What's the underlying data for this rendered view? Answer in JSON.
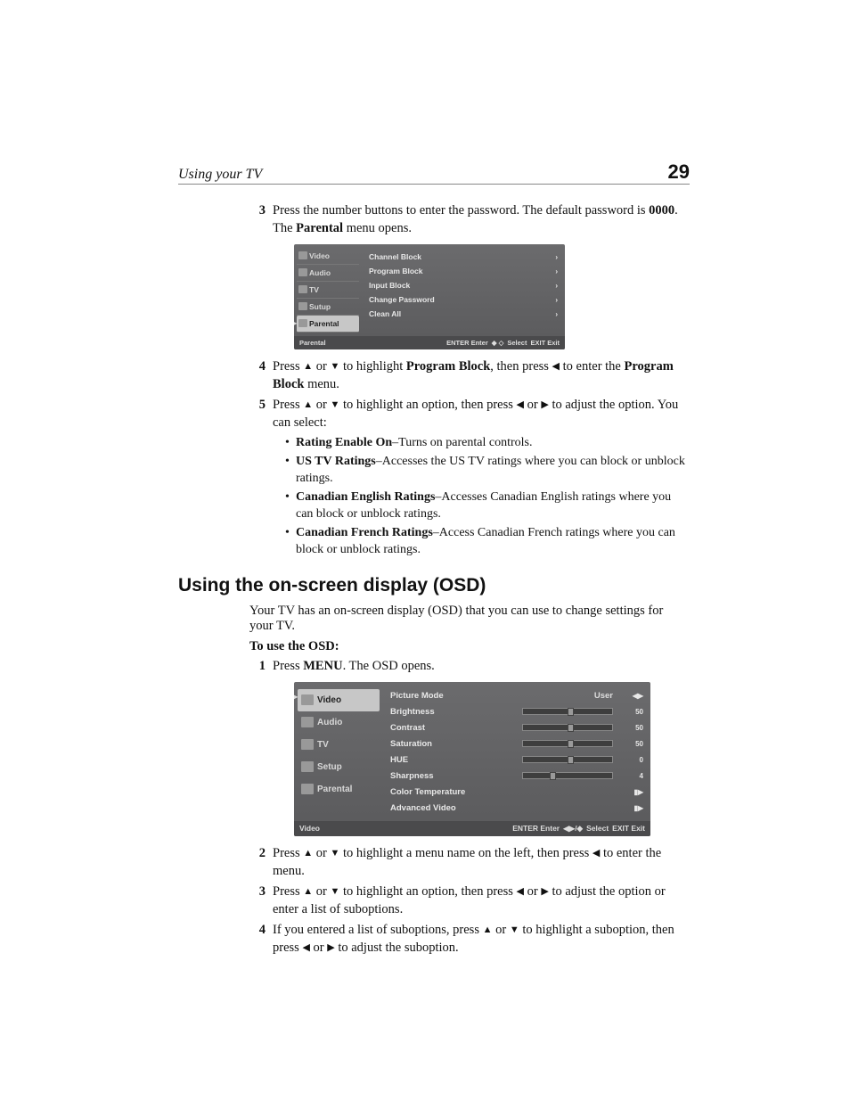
{
  "header": {
    "title": "Using your TV",
    "page_number": "29"
  },
  "steps_a": [
    {
      "num": "3",
      "parts": [
        {
          "t": "Press the number buttons to enter the password. The default password is "
        },
        {
          "t": "0000",
          "bold": true
        },
        {
          "t": ". The "
        },
        {
          "t": "Parental",
          "bold": true
        },
        {
          "t": " menu opens."
        }
      ]
    }
  ],
  "parental_osd": {
    "side": [
      {
        "label": "Video",
        "selected": false
      },
      {
        "label": "Audio",
        "selected": false
      },
      {
        "label": "TV",
        "selected": false
      },
      {
        "label": "Sutup",
        "selected": false
      },
      {
        "label": "Parental",
        "selected": true
      }
    ],
    "rows": [
      {
        "label": "Channel Block",
        "arrow": "›"
      },
      {
        "label": "Program Block",
        "arrow": "›"
      },
      {
        "label": "Input Block",
        "arrow": "›"
      },
      {
        "label": "Change Password",
        "arrow": "›"
      },
      {
        "label": "Clean All",
        "arrow": "›"
      }
    ],
    "footer_left": "Parental",
    "footer_right": [
      "ENTER Enter",
      "◆ ◇",
      "Select",
      "EXIT Exit"
    ]
  },
  "steps_b": [
    {
      "num": "4",
      "parts": [
        {
          "t": "Press "
        },
        {
          "arrow": "▲"
        },
        {
          "t": " or "
        },
        {
          "arrow": "▼"
        },
        {
          "t": " to highlight "
        },
        {
          "t": "Program Block",
          "bold": true
        },
        {
          "t": ", then press "
        },
        {
          "arrow": "◀"
        },
        {
          "t": " to enter the "
        },
        {
          "t": "Program Block",
          "bold": true
        },
        {
          "t": " menu."
        }
      ]
    },
    {
      "num": "5",
      "parts": [
        {
          "t": "Press "
        },
        {
          "arrow": "▲"
        },
        {
          "t": " or "
        },
        {
          "arrow": "▼"
        },
        {
          "t": " to highlight an option, then press "
        },
        {
          "arrow": "◀"
        },
        {
          "t": " or "
        },
        {
          "arrow": "▶"
        },
        {
          "t": " to adjust the option. You can select:"
        }
      ],
      "subs": [
        {
          "bold": "Rating Enable On",
          "rest": "–Turns on parental controls."
        },
        {
          "bold": "US TV Ratings",
          "rest": "–Accesses the US TV ratings where you can block or unblock ratings."
        },
        {
          "bold": "Canadian English Ratings",
          "rest": "–Accesses Canadian English ratings where you can block or unblock ratings."
        },
        {
          "bold": "Canadian French Ratings",
          "rest": "–Access Canadian French ratings where you can block or unblock ratings."
        }
      ]
    }
  ],
  "section_title": "Using the on-screen display (OSD)",
  "lead_a": "Your TV has an on-screen display (OSD) that you can use to change settings for your TV.",
  "lead_b": "To use the OSD:",
  "steps_c": [
    {
      "num": "1",
      "parts": [
        {
          "t": "Press "
        },
        {
          "t": "MENU",
          "bold": true
        },
        {
          "t": ". The OSD opens."
        }
      ]
    }
  ],
  "video_osd": {
    "side": [
      {
        "label": "Video",
        "selected": true
      },
      {
        "label": "Audio",
        "selected": false
      },
      {
        "label": "TV",
        "selected": false
      },
      {
        "label": "Setup",
        "selected": false
      },
      {
        "label": "Parental",
        "selected": false
      }
    ],
    "rows": [
      {
        "label": "Picture Mode",
        "mid_text": "User",
        "val": "◀▶"
      },
      {
        "label": "Brightness",
        "slider": 50,
        "val": "50"
      },
      {
        "label": "Contrast",
        "slider": 50,
        "val": "50"
      },
      {
        "label": "Saturation",
        "slider": 50,
        "val": "50"
      },
      {
        "label": "HUE",
        "slider": 50,
        "val": "0"
      },
      {
        "label": "Sharpness",
        "slider": 30,
        "val": "4"
      },
      {
        "label": "Color Temperature",
        "val": "▮▶"
      },
      {
        "label": "Advanced Video",
        "val": "▮▶"
      }
    ],
    "footer_left": "Video",
    "footer_right": [
      "ENTER Enter",
      "◀▶/◆",
      "Select",
      "EXIT Exit"
    ]
  },
  "steps_d": [
    {
      "num": "2",
      "parts": [
        {
          "t": "Press "
        },
        {
          "arrow": "▲"
        },
        {
          "t": " or "
        },
        {
          "arrow": "▼"
        },
        {
          "t": " to highlight a menu name on the left, then press "
        },
        {
          "arrow": "◀"
        },
        {
          "t": " to enter the menu."
        }
      ]
    },
    {
      "num": "3",
      "parts": [
        {
          "t": "Press "
        },
        {
          "arrow": "▲"
        },
        {
          "t": " or "
        },
        {
          "arrow": "▼"
        },
        {
          "t": " to highlight an option, then press "
        },
        {
          "arrow": "◀"
        },
        {
          "t": " or "
        },
        {
          "arrow": "▶"
        },
        {
          "t": " to adjust the option or enter a list of suboptions."
        }
      ]
    },
    {
      "num": "4",
      "parts": [
        {
          "t": "If you entered a list of suboptions, press "
        },
        {
          "arrow": "▲"
        },
        {
          "t": " or "
        },
        {
          "arrow": "▼"
        },
        {
          "t": " to highlight a suboption, then press "
        },
        {
          "arrow": "◀"
        },
        {
          "t": " or "
        },
        {
          "arrow": "▶"
        },
        {
          "t": " to adjust the suboption."
        }
      ]
    }
  ]
}
